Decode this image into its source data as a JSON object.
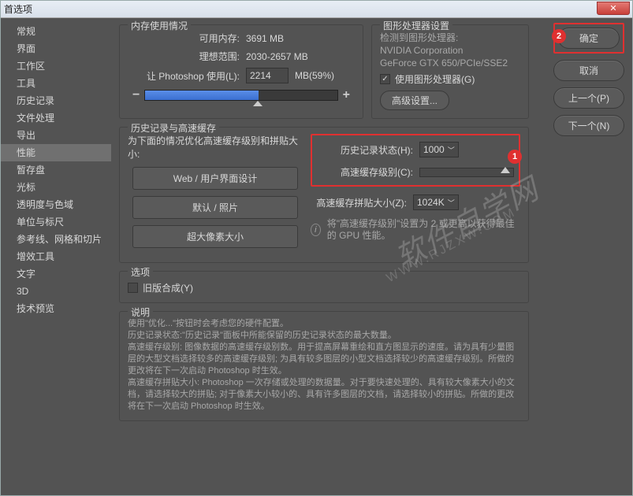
{
  "window": {
    "title": "首选项"
  },
  "sidebar": {
    "items": [
      {
        "label": "常规"
      },
      {
        "label": "界面"
      },
      {
        "label": "工作区"
      },
      {
        "label": "工具"
      },
      {
        "label": "历史记录"
      },
      {
        "label": "文件处理"
      },
      {
        "label": "导出"
      },
      {
        "label": "性能",
        "selected": true
      },
      {
        "label": "暂存盘"
      },
      {
        "label": "光标"
      },
      {
        "label": "透明度与色域"
      },
      {
        "label": "单位与标尺"
      },
      {
        "label": "参考线、网格和切片"
      },
      {
        "label": "增效工具"
      },
      {
        "label": "文字"
      },
      {
        "label": "3D"
      },
      {
        "label": "技术预览"
      }
    ]
  },
  "rightButtons": {
    "ok": "确定",
    "cancel": "取消",
    "prev": "上一个(P)",
    "next": "下一个(N)"
  },
  "memory": {
    "legend": "内存使用情况",
    "available_label": "可用内存:",
    "available_value": "3691 MB",
    "ideal_label": "理想范围:",
    "ideal_value": "2030-2657 MB",
    "ps_use_label": "让 Photoshop 使用(L):",
    "ps_use_value": "2214",
    "ps_use_unit": "MB(59%)",
    "slider_percent": 59
  },
  "gpu": {
    "legend": "图形处理器设置",
    "detected_label": "检测到图形处理器:",
    "vendor": "NVIDIA Corporation",
    "model": "GeForce GTX 650/PCIe/SSE2",
    "use_gpu": "使用图形处理器(G)",
    "use_gpu_checked": true,
    "advanced": "高级设置..."
  },
  "history": {
    "legend": "历史记录与高速缓存",
    "optimize_text": "为下面的情况优化高速缓存级别和拼贴大小:",
    "btn_web": "Web / 用户界面设计",
    "btn_default": "默认 / 照片",
    "btn_huge": "超大像素大小",
    "states_label": "历史记录状态(H):",
    "states_value": "1000",
    "cache_level_label": "高速缓存级别(C):",
    "tile_label": "高速缓存拼贴大小(Z):",
    "tile_value": "1024K",
    "gpu_note": "将\"高速缓存级别\"设置为 2 或更高以获得最佳的 GPU 性能。"
  },
  "options": {
    "legend": "选项",
    "legacy": "旧版合成(Y)",
    "legacy_checked": false
  },
  "desc": {
    "legend": "说明",
    "text": "使用\"优化...\"按钮时会考虑您的硬件配置。\n历史记录状态:\"历史记录\"面板中所能保留的历史记录状态的最大数量。\n高速缓存级别: 图像数据的高速缓存级别数。用于提高屏幕重绘和直方图显示的速度。请为具有少量图层的大型文档选择较多的高速缓存级别; 为具有较多图层的小型文档选择较少的高速缓存级别。所做的更改将在下一次启动 Photoshop 时生效。\n高速缓存拼贴大小: Photoshop 一次存储或处理的数据量。对于要快速处理的、具有较大像素大小的文档，请选择较大的拼贴; 对于像素大小较小的、具有许多图层的文档，请选择较小的拼贴。所做的更改将在下一次启动 Photoshop 时生效。"
  },
  "callouts": {
    "c1": "1",
    "c2": "2"
  },
  "watermark": {
    "main": "软件自学网",
    "sub": "WWW.RJZXW.COM"
  }
}
